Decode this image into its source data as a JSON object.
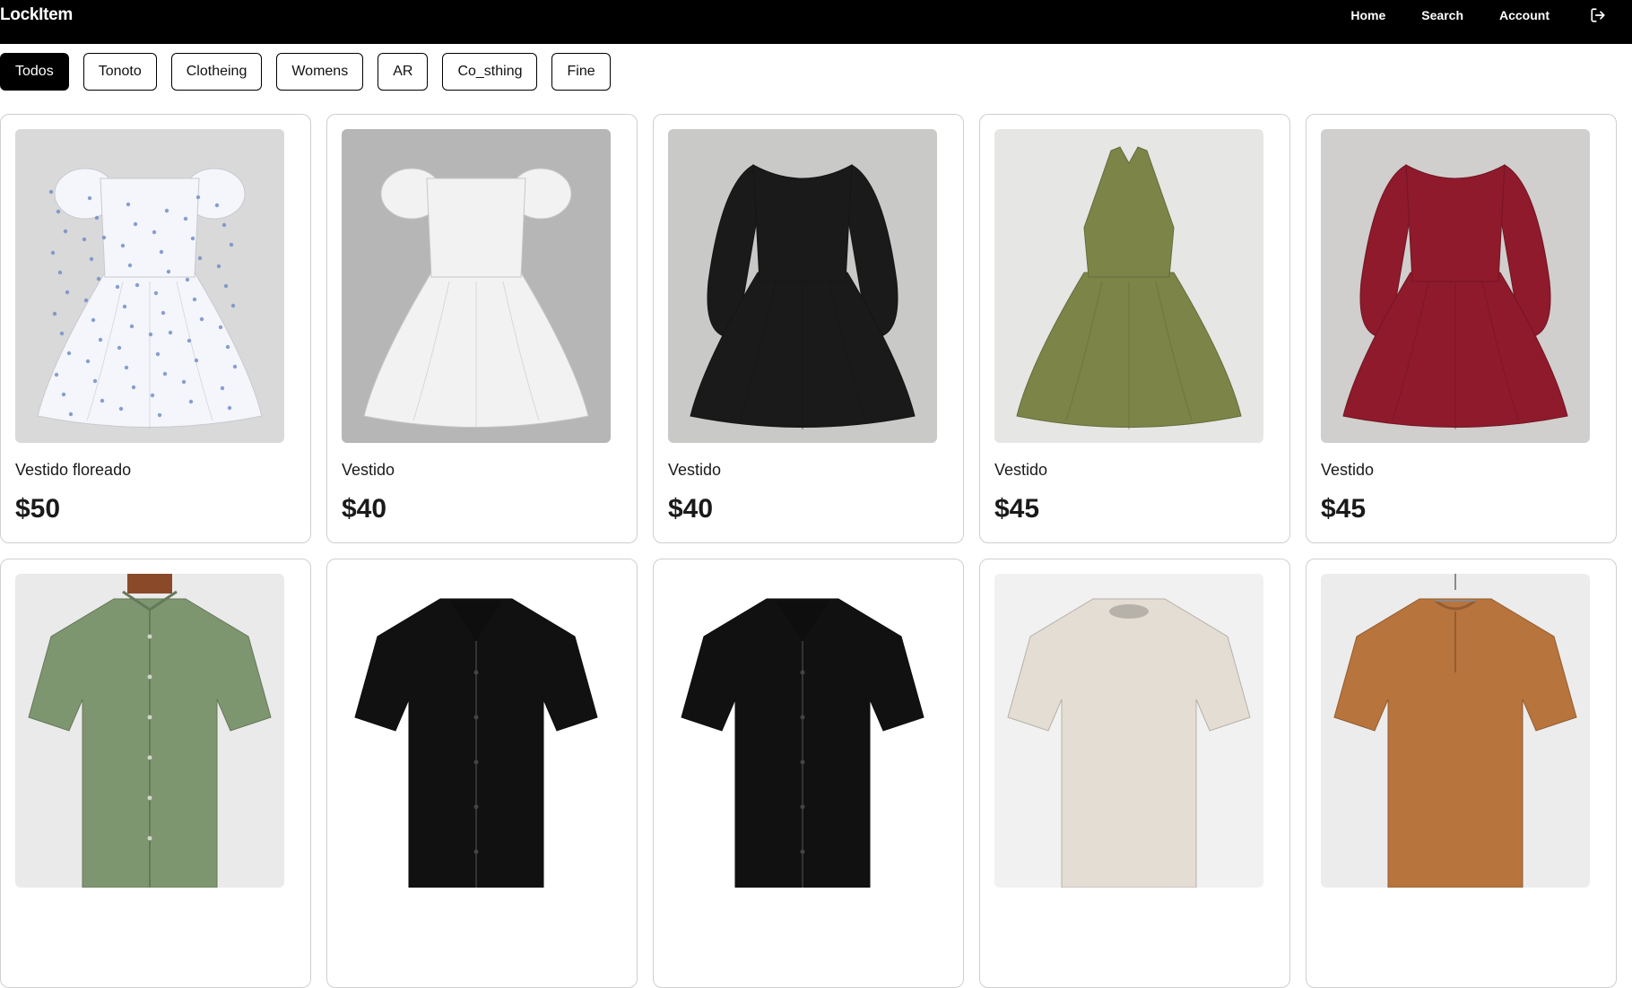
{
  "header": {
    "brand": "LockItem",
    "nav": {
      "home": "Home",
      "search": "Search",
      "account": "Account"
    },
    "logout_icon": "logout-icon"
  },
  "filters": [
    {
      "label": "Todos",
      "active": true
    },
    {
      "label": "Tonoto"
    },
    {
      "label": "Clotheing"
    },
    {
      "label": "Womens"
    },
    {
      "label": "AR"
    },
    {
      "label": "Co_sthing"
    },
    {
      "label": "Fine"
    }
  ],
  "products": [
    {
      "title": "Vestido floreado",
      "price": "$50",
      "image": "floral-dress",
      "bg": "#d9d9d9",
      "color": "#f4f6fb"
    },
    {
      "title": "Vestido",
      "price": "$40",
      "image": "white-dress",
      "bg": "#b5b6b5",
      "color": "#f2f2f2"
    },
    {
      "title": "Vestido",
      "price": "$40",
      "image": "black-dress",
      "bg": "#c9c9c7",
      "color": "#1a1a1a"
    },
    {
      "title": "Vestido",
      "price": "$45",
      "image": "olive-halter-dress",
      "bg": "#e6e6e4",
      "color": "#7c8448"
    },
    {
      "title": "Vestido",
      "price": "$45",
      "image": "burgundy-dress",
      "bg": "#d0cfce",
      "color": "#8e1a2b"
    },
    {
      "title": "",
      "price": "",
      "image": "green-linen-shirt",
      "bg": "#eaeaea",
      "color": "#7e9670"
    },
    {
      "title": "",
      "price": "",
      "image": "black-shirt",
      "bg": "#ffffff",
      "color": "#111111"
    },
    {
      "title": "",
      "price": "",
      "image": "black-shirt",
      "bg": "#ffffff",
      "color": "#111111"
    },
    {
      "title": "",
      "price": "",
      "image": "beige-tshirt",
      "bg": "#f1f1f1",
      "color": "#e4ddd3"
    },
    {
      "title": "",
      "price": "",
      "image": "brown-henley-shirt",
      "bg": "#ececec",
      "color": "#b8743d"
    }
  ]
}
